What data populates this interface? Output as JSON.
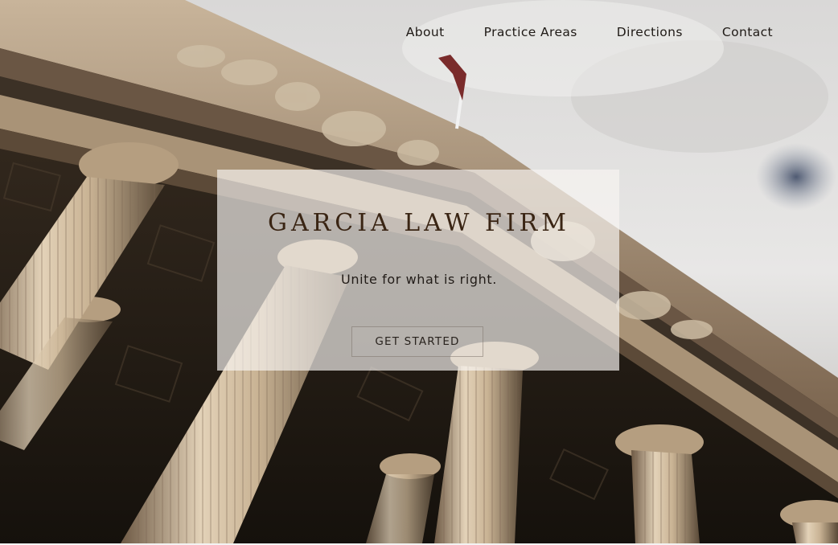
{
  "nav": {
    "items": [
      {
        "label": "About"
      },
      {
        "label": "Practice Areas"
      },
      {
        "label": "Directions"
      },
      {
        "label": "Contact"
      }
    ]
  },
  "hero": {
    "title": "GARCIA LAW FIRM",
    "tagline": "Unite for what is right.",
    "cta_label": "GET STARTED"
  },
  "colors": {
    "title": "#3a2514",
    "nav_text": "#1f1a16",
    "card_background": "#f7f5f2"
  }
}
